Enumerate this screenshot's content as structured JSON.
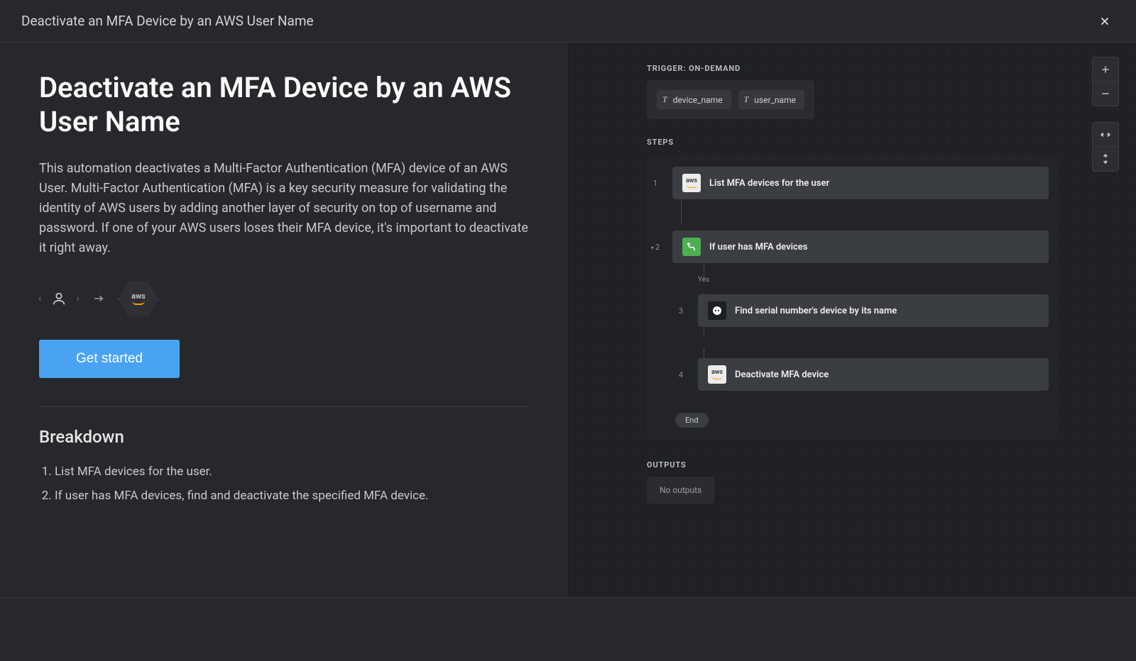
{
  "header": {
    "title": "Deactivate an MFA Device by an AWS User Name"
  },
  "left": {
    "heading": "Deactivate an MFA Device by an AWS User Name",
    "description": "This automation deactivates a Multi-Factor Authentication (MFA) device of an AWS User. Multi-Factor Authentication (MFA) is a key security measure for validating the identity of AWS users by adding another layer of security on top of username and password. If one of your AWS users loses their MFA device, it's important to deactivate it right away.",
    "cta": "Get started",
    "breakdown_title": "Breakdown",
    "breakdown": [
      "List MFA devices for the user.",
      "If user has MFA devices, find and deactivate the specified MFA device."
    ],
    "integration_target": "aws"
  },
  "right": {
    "trigger_label": "TRIGGER: ON-DEMAND",
    "trigger_params": [
      "device_name",
      "user_name"
    ],
    "steps_label": "STEPS",
    "steps": [
      {
        "num": "1",
        "icon": "aws",
        "label": "List MFA devices for the user"
      },
      {
        "num": "2",
        "icon": "cond",
        "label": "If user has MFA devices"
      },
      {
        "num": "3",
        "icon": "action",
        "label": "Find serial number's device by its name"
      },
      {
        "num": "4",
        "icon": "aws",
        "label": "Deactivate MFA device"
      }
    ],
    "branch_label": "Yes",
    "end_label": "End",
    "outputs_label": "OUTPUTS",
    "outputs_empty": "No outputs"
  },
  "colors": {
    "accent": "#4aa3f2",
    "aws_orange": "#ff9900",
    "cond_green": "#4caf50"
  }
}
